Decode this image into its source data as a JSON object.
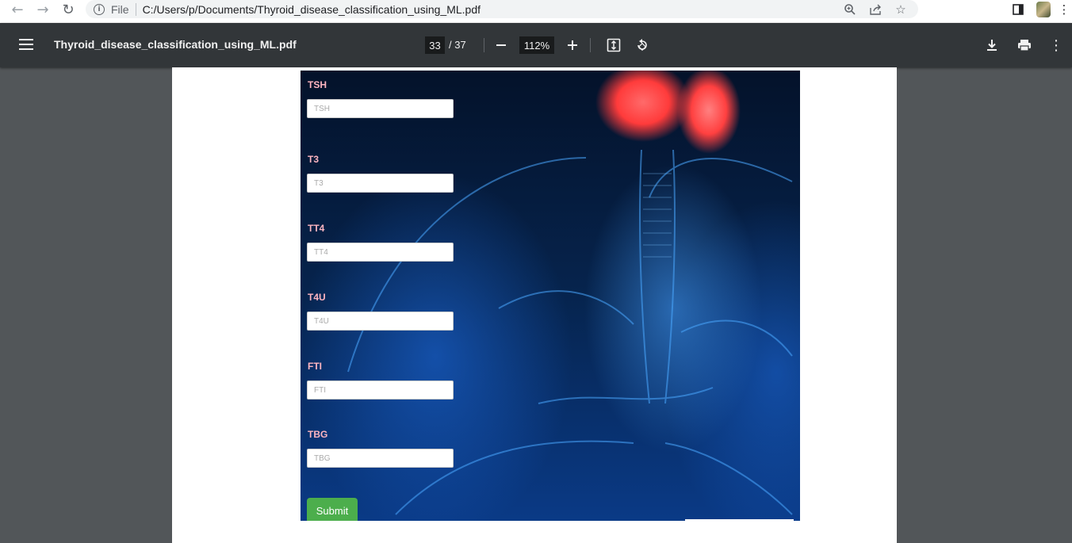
{
  "browser": {
    "scheme": "File",
    "url": "C:/Users/p/Documents/Thyroid_disease_classification_using_ML.pdf"
  },
  "toolbar": {
    "title": "Thyroid_disease_classification_using_ML.pdf",
    "page_current": "33",
    "page_total": "/ 37",
    "zoom": "112%"
  },
  "form": {
    "fields": [
      {
        "label": "TSH",
        "placeholder": "TSH"
      },
      {
        "label": "T3",
        "placeholder": "T3"
      },
      {
        "label": "TT4",
        "placeholder": "TT4"
      },
      {
        "label": "T4U",
        "placeholder": "T4U"
      },
      {
        "label": "FTI",
        "placeholder": "FTI"
      },
      {
        "label": "TBG",
        "placeholder": "TBG"
      }
    ],
    "submit_label": "Submit"
  },
  "colors": {
    "toolbar_bg": "#323639",
    "viewer_bg": "#525659",
    "label_color": "#ffb6c1",
    "submit_bg": "#4cae4c"
  }
}
